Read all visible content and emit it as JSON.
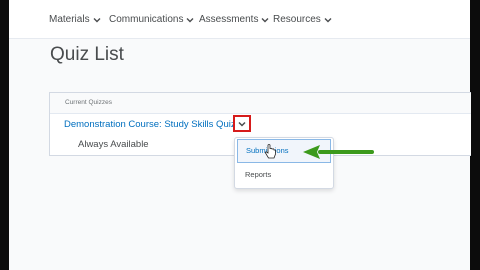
{
  "nav": {
    "items": [
      {
        "label": "Materials"
      },
      {
        "label": "Communications"
      },
      {
        "label": "Assessments"
      },
      {
        "label": "Resources"
      }
    ]
  },
  "page": {
    "title": "Quiz List"
  },
  "quizzes": {
    "header": "Current Quizzes",
    "items": [
      {
        "name": "Demonstration Course: Study Skills Quiz",
        "availability": "Always Available"
      }
    ]
  },
  "context_menu": {
    "items": [
      {
        "label": "Submissions"
      },
      {
        "label": "Reports"
      }
    ]
  },
  "colors": {
    "link": "#006fbf",
    "highlight_box": "#d61b1b",
    "annotation_arrow": "#3c9a1c"
  }
}
